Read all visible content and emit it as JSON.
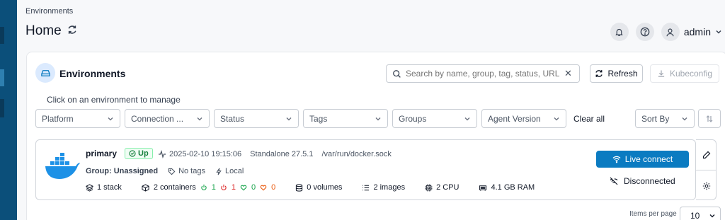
{
  "breadcrumb": "Environments",
  "page_title": "Home",
  "user": {
    "name": "admin"
  },
  "panel": {
    "title": "Environments",
    "search_placeholder": "Search by name, group, tag, status, URL...",
    "refresh_label": "Refresh",
    "kubeconfig_label": "Kubeconfig",
    "hint": "Click on an environment to manage",
    "filters": [
      "Platform",
      "Connection ...",
      "Status",
      "Tags",
      "Groups",
      "Agent Version"
    ],
    "clear_label": "Clear all",
    "sort_label": "Sort By"
  },
  "environment": {
    "name": "primary",
    "status": "Up",
    "timestamp": "2025-02-10 19:15:06",
    "type": "Standalone 27.5.1",
    "url": "/var/run/docker.sock",
    "group": "Group: Unassigned",
    "tags": "No tags",
    "location": "Local",
    "stacks": "1 stack",
    "containers": "2 containers",
    "running": "1",
    "stopped": "1",
    "healthy": "0",
    "unhealthy": "0",
    "volumes": "0 volumes",
    "images": "2 images",
    "cpu": "2 CPU",
    "ram": "4.1 GB RAM",
    "live_label": "Live connect",
    "disconnected_label": "Disconnected"
  },
  "pagination": {
    "label": "Items per page",
    "value": "10"
  },
  "colors": {
    "sidebar": "#0b4f7a",
    "primary_button": "#0b7bc1",
    "docker_blue": "#1d91e6",
    "status_up": "#15803d"
  }
}
